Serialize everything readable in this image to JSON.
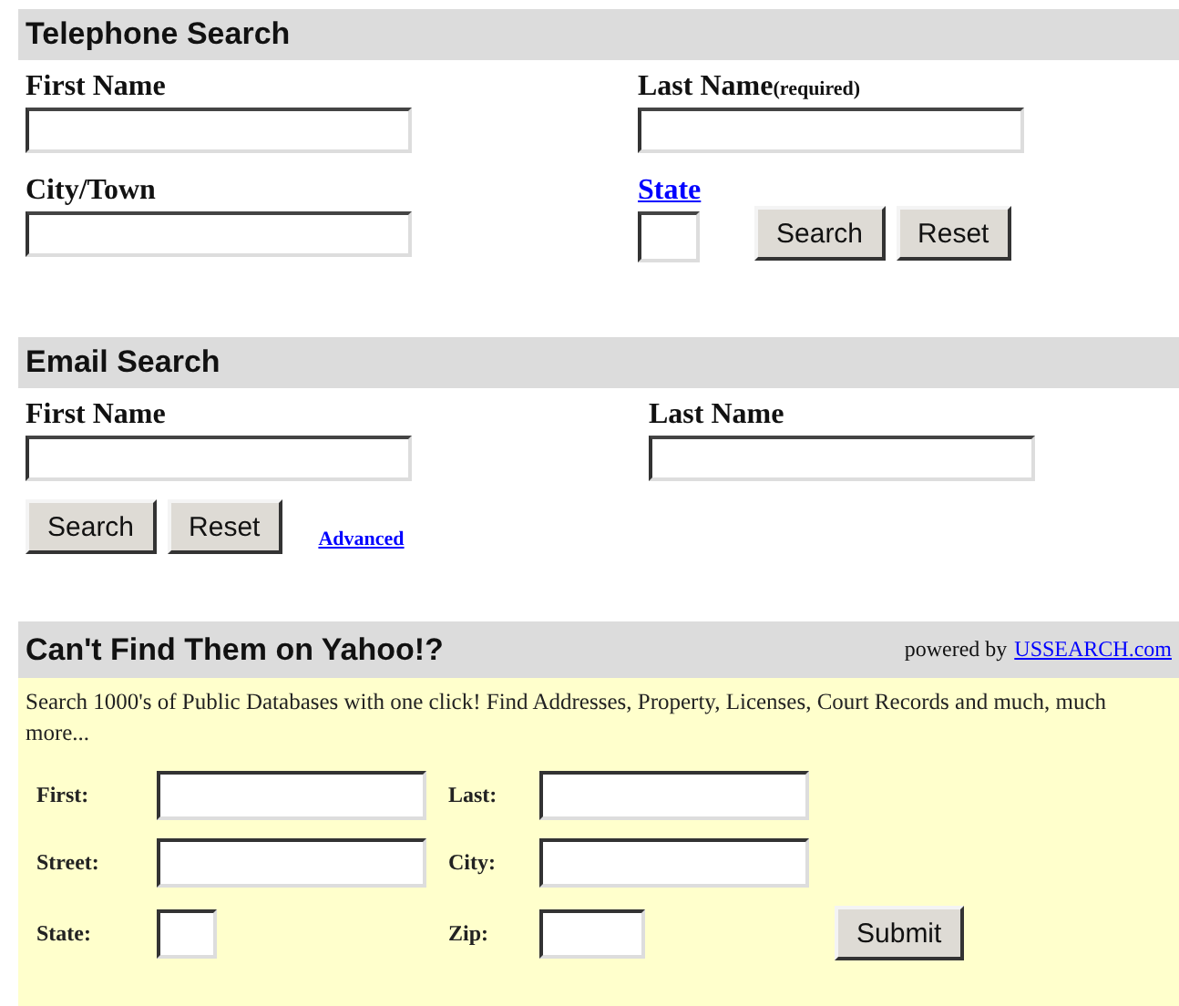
{
  "telephone_search": {
    "title": "Telephone Search",
    "first_name": {
      "label": "First Name"
    },
    "last_name": {
      "label": "Last Name",
      "note": "(required)"
    },
    "city": {
      "label": "City/Town"
    },
    "state": {
      "label": "State"
    },
    "buttons": [
      "Search",
      "Reset"
    ]
  },
  "email_search": {
    "title": "Email Search",
    "first_name": {
      "label": "First Name"
    },
    "last_name": {
      "label": "Last Name"
    },
    "buttons": [
      "Search",
      "Reset"
    ],
    "advanced_link": "Advanced"
  },
  "ussearch": {
    "title": "Can't Find Them on Yahoo!?",
    "powered_by": "powered by",
    "provider_link": "USSEARCH.com",
    "description": "Search 1000's of Public Databases with one click! Find Addresses, Property, Licenses, Court Records and much, much more...",
    "rows": [
      [
        {
          "label": "First:",
          "kind": "wide"
        },
        {
          "label": "Last:",
          "kind": "wide"
        }
      ],
      [
        {
          "label": "Street:",
          "kind": "wide"
        },
        {
          "label": "City:",
          "kind": "wide"
        }
      ],
      [
        {
          "label": "State:",
          "kind": "small"
        },
        {
          "label": "Zip:",
          "kind": "medium"
        }
      ]
    ],
    "submit": "Submit"
  }
}
